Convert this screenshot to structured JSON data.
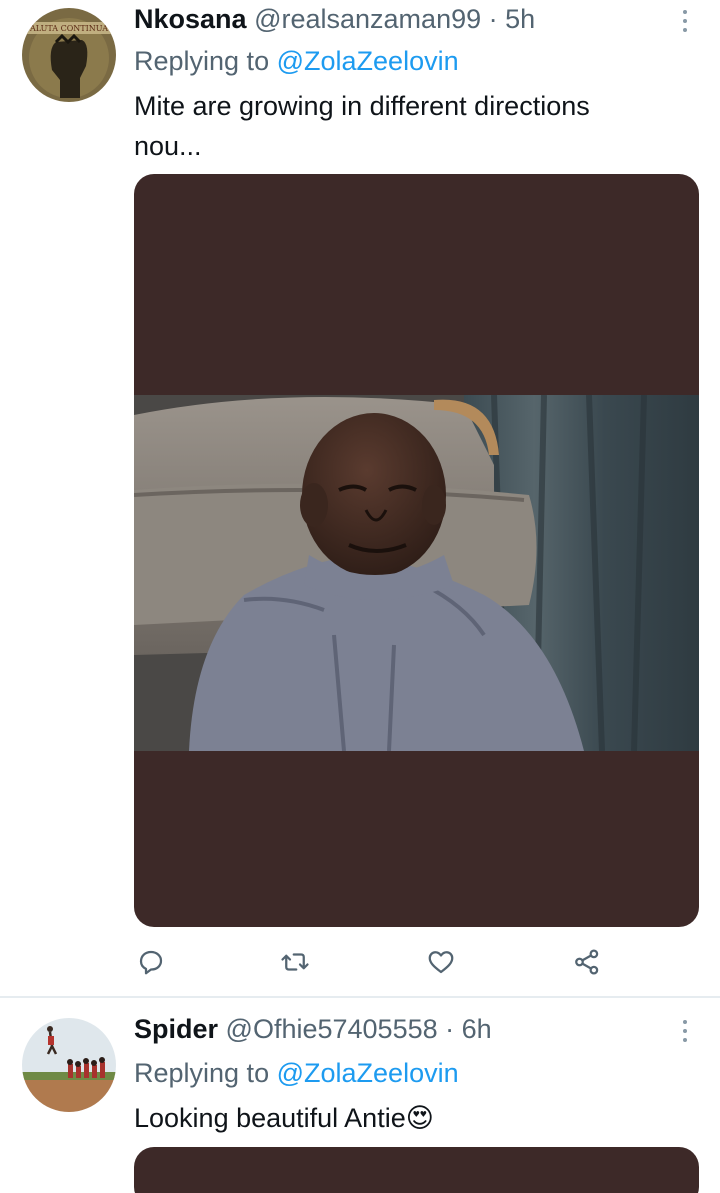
{
  "tweets": [
    {
      "author_name": "Nkosana",
      "author_handle": "@realsanzaman99",
      "separator": "·",
      "time": "5h",
      "replying_prefix": "Replying to",
      "replying_to": "@ZolaZeelovin",
      "text_line1": "Mite are growing in different directions",
      "text_line2": "nou...",
      "avatar_caption": "ALUTA CONTINUA",
      "media_background": "#3d2928"
    },
    {
      "author_name": "Spider",
      "author_handle": "@Ofhie57405558",
      "separator": "·",
      "time": "6h",
      "replying_prefix": "Replying to",
      "replying_to": "@ZolaZeelovin",
      "text": "Looking beautiful Antie",
      "emoji": "😍"
    }
  ],
  "actions": {
    "reply_icon": "reply-icon",
    "retweet_icon": "retweet-icon",
    "like_icon": "like-icon",
    "share_icon": "share-icon"
  },
  "colors": {
    "link": "#1d9bf0",
    "secondary_text": "#536471",
    "primary_text": "#0f1419",
    "divider": "#e6ecf0"
  }
}
